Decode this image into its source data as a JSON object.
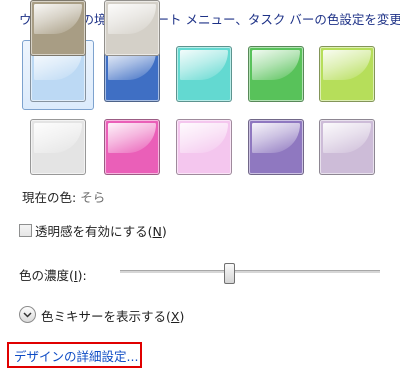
{
  "heading": "ウィンドウの境界、スタート メニュー、タスク バーの色設定を変更します",
  "swatches": {
    "selected_index": 0,
    "items": [
      {
        "name": "sky",
        "color": "#bcd9f4"
      },
      {
        "name": "twilight",
        "color": "#3f6fc4"
      },
      {
        "name": "sea",
        "color": "#63d9d1"
      },
      {
        "name": "leaf",
        "color": "#58c25a"
      },
      {
        "name": "lime",
        "color": "#b6de5a"
      },
      {
        "name": "unnamed-6",
        "color": "#e4e4e4"
      },
      {
        "name": "fuchsia",
        "color": "#ea5fb8"
      },
      {
        "name": "blush",
        "color": "#f4c6ee"
      },
      {
        "name": "violet",
        "color": "#8f78c0"
      },
      {
        "name": "lavender",
        "color": "#cdbcd8"
      },
      {
        "name": "taupe",
        "color": "#a89d84"
      },
      {
        "name": "unnamed-12",
        "color": "#d4d0c8"
      }
    ]
  },
  "current_color": {
    "label": "現在の色:",
    "value": "そら"
  },
  "transparency": {
    "label": "透明感を有効にする(",
    "accel": "N",
    "suffix": ")",
    "checked": false
  },
  "intensity": {
    "label": "色の濃度(",
    "accel": "I",
    "suffix": "):",
    "value_fraction": 0.42
  },
  "mixer": {
    "label": "色ミキサーを表示する(",
    "accel": "X",
    "suffix": ")"
  },
  "advanced_link": "デザインの詳細設定...",
  "colors": {
    "link": "#0f4cc5",
    "heading": "#1e3287",
    "highlight_box": "#e00000"
  }
}
